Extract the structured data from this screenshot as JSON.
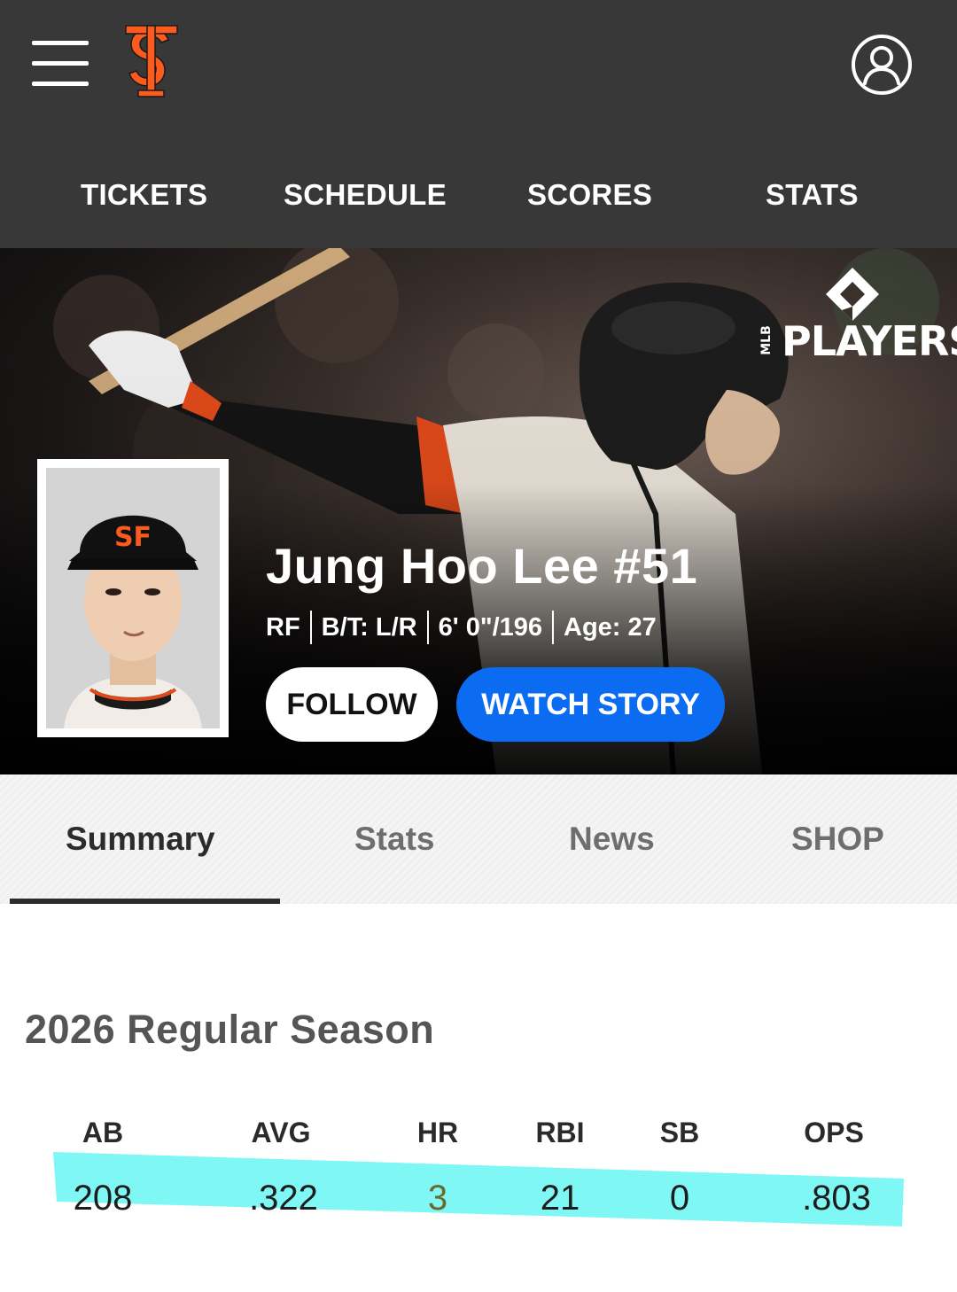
{
  "header": {
    "menu_icon": "hamburger-icon",
    "logo": "sf-giants-logo",
    "account_icon": "user-account-icon",
    "nav": [
      {
        "label": "TICKETS"
      },
      {
        "label": "SCHEDULE"
      },
      {
        "label": "SCORES"
      },
      {
        "label": "STATS"
      }
    ]
  },
  "hero": {
    "badge_text": "PLAYERS",
    "badge_small": "MLB",
    "player_name": "Jung Hoo Lee #51",
    "position": "RF",
    "bats_throws": "B/T: L/R",
    "height_weight": "6' 0\"/196",
    "age": "Age: 27",
    "follow_label": "FOLLOW",
    "watch_label": "WATCH STORY"
  },
  "tabs": [
    {
      "label": "Summary",
      "active": true
    },
    {
      "label": "Stats"
    },
    {
      "label": "News"
    },
    {
      "label": "SHOP"
    }
  ],
  "season": {
    "title": "2026 Regular Season",
    "columns": [
      "AB",
      "AVG",
      "HR",
      "RBI",
      "SB",
      "OPS"
    ],
    "values": [
      "208",
      ".322",
      "3",
      "21",
      "0",
      ".803"
    ],
    "highlight_color": "#7ef7f5"
  },
  "colors": {
    "topbar": "#383838",
    "brand_orange": "#fd5a1e",
    "watch_button": "#0b6cf2"
  }
}
